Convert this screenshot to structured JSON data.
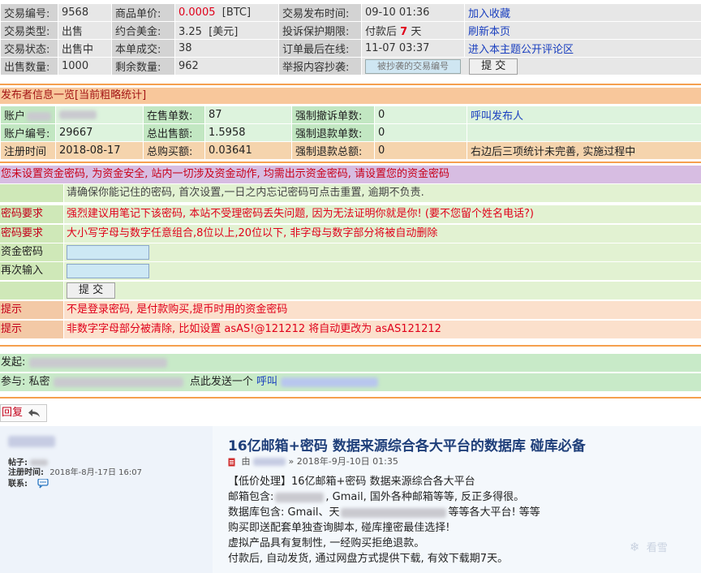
{
  "trade_info": {
    "rows": [
      {
        "l1": "交易编号:",
        "v1": "9568",
        "l2": "商品单价:",
        "v2": "0.0005",
        "v2_unit": "[BTC]",
        "l3": "交易发布时间:",
        "v3": "09-10 01:36",
        "link": "加入收藏"
      },
      {
        "l1": "交易类型:",
        "v1": "出售",
        "l2": "约合美金:",
        "v2": "3.25",
        "v2_unit": "[美元]",
        "l3": "投诉保护期限:",
        "v3_prefix": "付款后",
        "v3_num": "7",
        "v3_suffix": "天",
        "link": "刷新本页"
      },
      {
        "l1": "交易状态:",
        "v1": "出售中",
        "l2": "本单成交:",
        "v2": "38",
        "l3": "订单最后在线:",
        "v3": "11-07 03:37",
        "link": "进入本主题公开评论区"
      },
      {
        "l1": "出售数量:",
        "v1": "1000",
        "l2": "剩余数量:",
        "v2": "962",
        "l3": "举报内容抄袭:",
        "report_placeholder": "被抄袭的交易编号",
        "report_submit": "提 交"
      }
    ]
  },
  "publisher": {
    "title": "发布者信息一览[当前粗略统计]",
    "rows": [
      {
        "l1": "账户",
        "l2": "在售单数:",
        "v2": "87",
        "l3": "强制撤诉单数:",
        "v3": "0",
        "note": "呼叫发布人"
      },
      {
        "l1": "账户编号:",
        "v1": "29667",
        "l2": "总出售额:",
        "v2": "1.5958",
        "l3": "强制退款单数:",
        "v3": "0",
        "note": ""
      },
      {
        "l1": "注册时间",
        "v1": "2018-08-17",
        "l2": "总购买额:",
        "v2": "0.03641",
        "l3": "强制退款总额:",
        "v3": "0",
        "note": "右边后三项统计未完善, 实施过程中"
      }
    ]
  },
  "fund_password": {
    "header": "您未设置资金密码, 为资金安全, 站内一切涉及资金动作, 均需出示资金密码, 请设置您的资金密码",
    "intro": "请确保你能记住的密码, 首次设置,一日之内忘记密码可点击重置, 逾期不负责.",
    "req1_label": "密码要求",
    "req1_text": "强烈建议用笔记下该密码, 本站不受理密码丢失问题, 因为无法证明你就是你! (要不您留个姓名电话?)",
    "req2_label": "密码要求",
    "req2_text": "大小写字母与数字任意组合,8位以上,20位以下, 非字母与数字部分将被自动删除",
    "pwd_label": "资金密码",
    "repeat_label": "再次输入",
    "submit": "提 交",
    "tip1_label": "提示",
    "tip1_text": "不是登录密码, 是付款购买,提币时用的资金密码",
    "tip2_label": "提示",
    "tip2_text": "非数字字母部分被清除, 比如设置 asAS!@121212 将自动更改为 asAS121212"
  },
  "discussion": {
    "initiator_label": "发起:",
    "participant_label": "参与:",
    "participant_text": "私密",
    "call_text": "点此发送一个",
    "call_link": "呼叫"
  },
  "reply_button": "回复",
  "post": {
    "meta_posts_label": "帖子:",
    "meta_reg_label": "注册时间:",
    "meta_reg_value": "2018年-8月-17日 16:07",
    "meta_contact_label": "联系:",
    "title": "16亿邮箱+密码 数据来源综合各大平台的数据库 碰库必备",
    "byline_prefix": "由",
    "byline_date": "» 2018年-9月-10日 01:35",
    "body_lines": [
      "【低价处理】16亿邮箱+密码 数据来源综合各大平台",
      "邮箱包含:",
      "数据库包含: Gmail、天",
      "购买即送配套单独查询脚本, 碰库撞密最佳选择!",
      "虚拟产品具有复制性, 一经购买拒绝退款。",
      "付款后, 自动发货, 通过网盘方式提供下载, 有效下载期7天。"
    ],
    "line2_after": ", Gmail, 国外各种邮箱等等, 反正多得很。",
    "line3_after": "等等各大平台! 等等",
    "watermark": "看雪"
  }
}
